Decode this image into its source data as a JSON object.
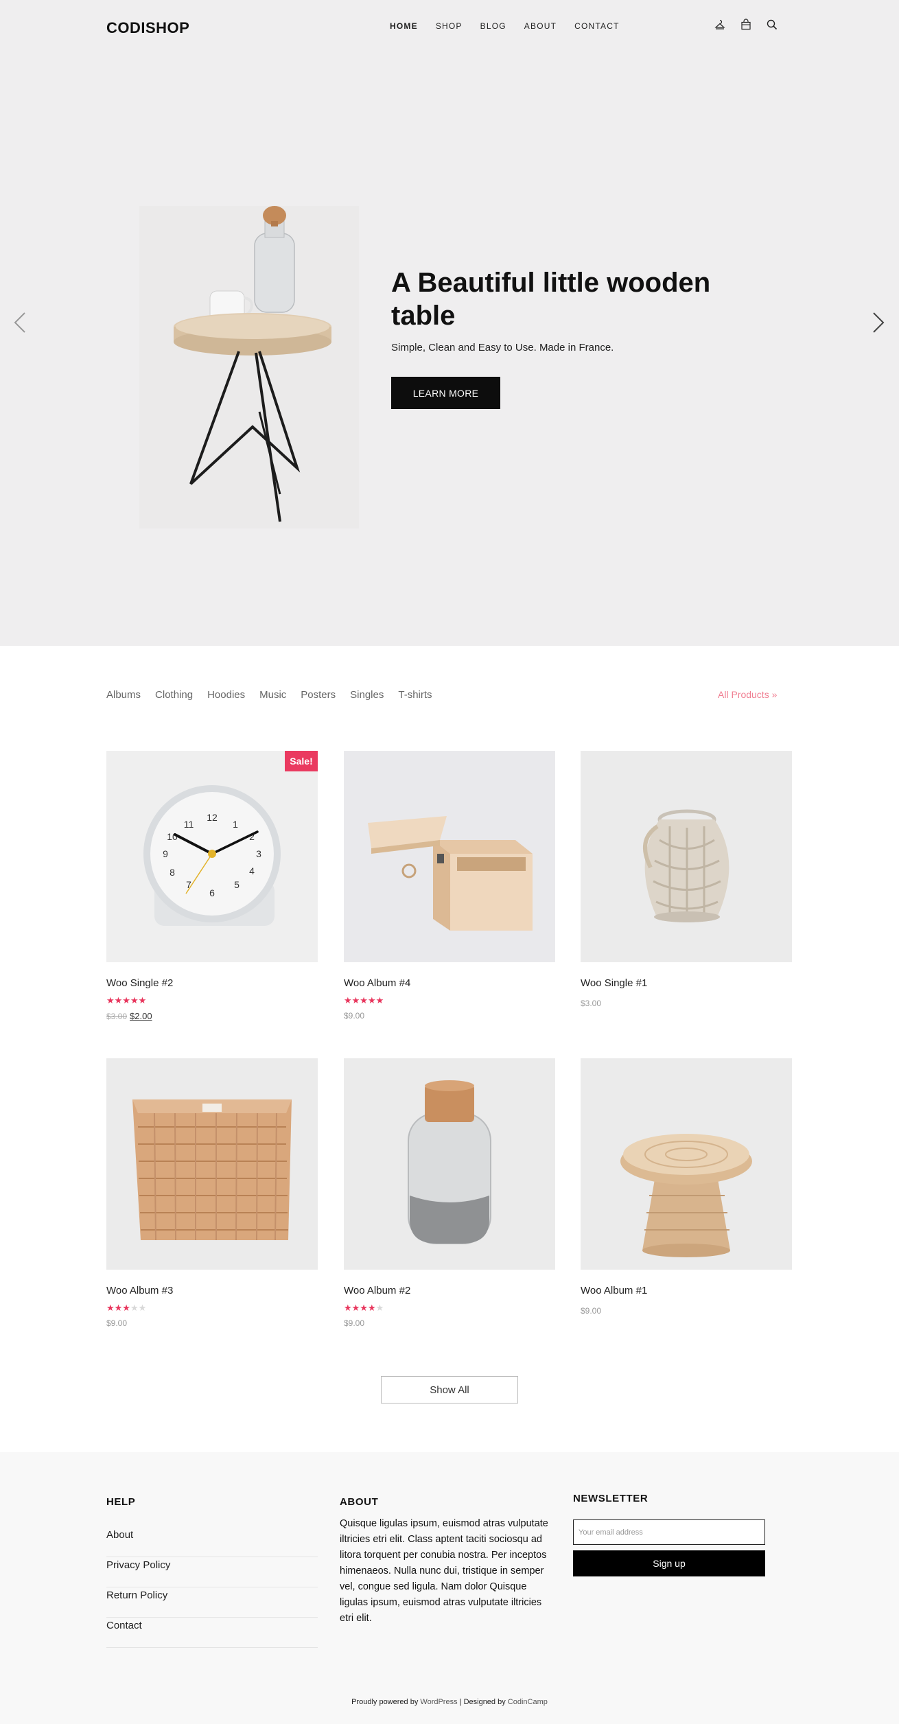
{
  "header": {
    "logo": "CODISHOP",
    "nav": [
      "HOME",
      "SHOP",
      "BLOG",
      "ABOUT",
      "CONTACT"
    ],
    "icons": [
      "account-icon",
      "cart-icon",
      "search-icon"
    ]
  },
  "hero": {
    "title": "A Beautiful little wooden table",
    "subtitle": "Simple, Clean and Easy to Use. Made in France.",
    "button": "LEARN MORE"
  },
  "categories": [
    "Albums",
    "Clothing",
    "Hoodies",
    "Music",
    "Posters",
    "Singles",
    "T-shirts"
  ],
  "all_products": "All Products »",
  "products": [
    {
      "name": "Woo Single #2",
      "rating": 4.5,
      "old_price": "$3.00",
      "price": "$2.00",
      "sale_badge": "Sale!"
    },
    {
      "name": "Woo Album #4",
      "rating": 5,
      "price": "$9.00"
    },
    {
      "name": "Woo Single #1",
      "price": "$3.00"
    },
    {
      "name": "Woo Album #3",
      "rating": 3,
      "price": "$9.00"
    },
    {
      "name": "Woo Album #2",
      "rating": 4,
      "price": "$9.00"
    },
    {
      "name": "Woo Album #1",
      "price": "$9.00"
    }
  ],
  "show_all": "Show All",
  "footer": {
    "help": {
      "title": "HELP",
      "links": [
        "About",
        "Privacy Policy",
        "Return Policy",
        "Contact"
      ]
    },
    "about": {
      "title": "ABOUT",
      "text": "Quisque ligulas ipsum, euismod atras vulputate iltricies etri elit. Class aptent taciti sociosqu ad litora torquent per conubia nostra. Per inceptos himenaeos. Nulla nunc dui, tristique in semper vel, congue sed ligula. Nam dolor Quisque ligulas ipsum, euismod atras vulputate iltricies etri elit."
    },
    "newsletter": {
      "title": "NEWSLETTER",
      "placeholder": "Your email address",
      "button": "Sign up"
    },
    "credits": {
      "prefix": "Proudly powered by",
      "wp": "WordPress",
      "mid": "| Designed by",
      "author": "CodinCamp"
    }
  },
  "colors": {
    "accent": "#ea3a60",
    "link_pink": "#f07f92",
    "hero_bg": "#efeeef",
    "footer_bg": "#f8f8f8"
  }
}
